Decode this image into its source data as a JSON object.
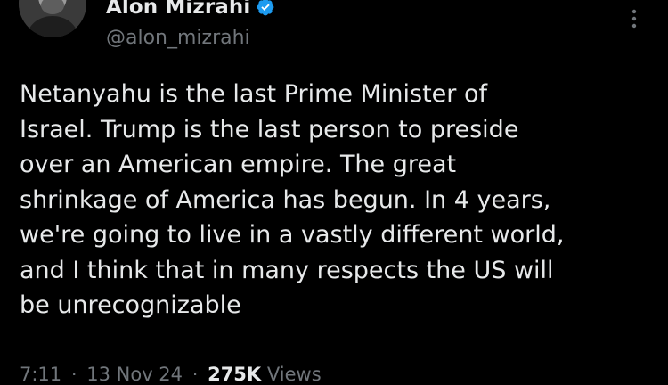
{
  "author": {
    "display_name": "Alon Mizrahi",
    "handle": "@alon_mizrahi",
    "verified": true,
    "verified_color": "#1d9bf0"
  },
  "icons": {
    "verified": "verified-badge-icon",
    "more": "more-vertical-icon"
  },
  "tweet": {
    "lines": [
      "Netanyahu is the last Prime Minister of",
      "Israel. Trump is the last person to preside",
      "over an American empire. The great",
      "shrinkage of America has begun. In 4 years,",
      "we're going to live in a vastly different world,",
      "and I think that in many respects the US will",
      "be unrecognizable"
    ]
  },
  "meta": {
    "time": "7:11",
    "separator": "·",
    "date": "13 Nov 24",
    "views_count": "275K",
    "views_label": "Views"
  },
  "colors": {
    "background": "#000000",
    "text": "#e7e9ea",
    "secondary_text": "#71767b"
  }
}
